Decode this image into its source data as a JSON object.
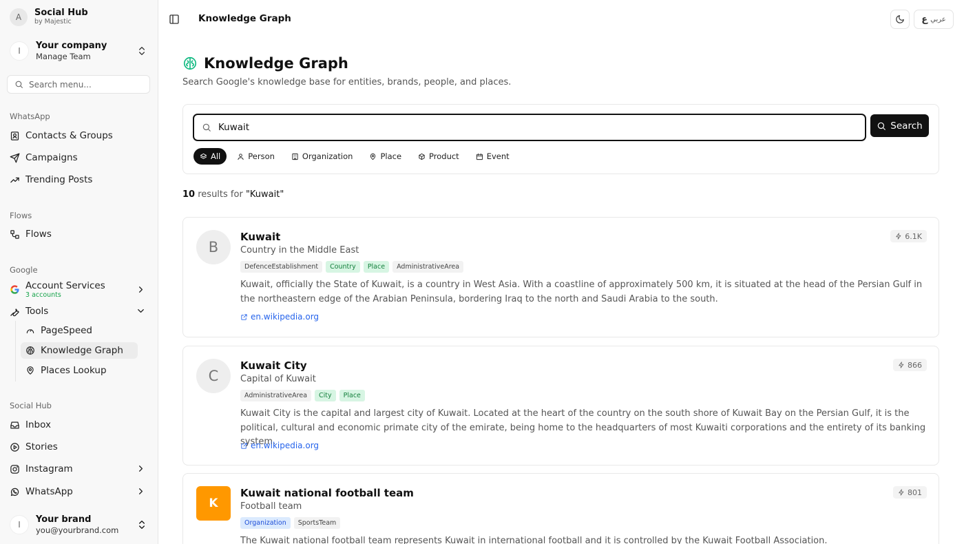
{
  "sidebar": {
    "brand": {
      "initial": "A",
      "name": "Social Hub",
      "sub": "by Majestic"
    },
    "company": {
      "initial": "I",
      "name": "Your company",
      "sub": "Manage Team"
    },
    "search_placeholder": "Search menu...",
    "sections": {
      "whatsapp": "WhatsApp",
      "flows": "Flows",
      "google": "Google",
      "social": "Social Hub"
    },
    "items": {
      "contacts": "Contacts & Groups",
      "campaigns": "Campaigns",
      "trending": "Trending Posts",
      "flows": "Flows",
      "account_services": "Account Services",
      "account_services_sub": "3 accounts",
      "tools": "Tools",
      "pagespeed": "PageSpeed",
      "knowledge_graph": "Knowledge Graph",
      "places_lookup": "Places Lookup",
      "inbox": "Inbox",
      "stories": "Stories",
      "instagram": "Instagram",
      "whatsapp": "WhatsApp"
    },
    "footer": {
      "initial": "I",
      "name": "Your brand",
      "email": "you@yourbrand.com"
    }
  },
  "header": {
    "title": "Knowledge Graph",
    "lang_glyph": "ع",
    "lang_label": "عربي"
  },
  "page": {
    "title": "Knowledge Graph",
    "subtitle": "Search Google's knowledge base for entities, brands, people, and places.",
    "search_value": "Kuwait",
    "search_button": "Search",
    "filters": [
      "All",
      "Person",
      "Organization",
      "Place",
      "Product",
      "Event"
    ],
    "results_count": "10",
    "results_text": "results for",
    "results_query": "\"Kuwait\"",
    "accent": "#10b981"
  },
  "results": [
    {
      "logo": "B",
      "name": "Kuwait",
      "description": "Country in the Middle East",
      "tags": [
        "DefenceEstablishment",
        "Country",
        "Place",
        "AdministrativeArea"
      ],
      "body": "Kuwait, officially the State of Kuwait, is a country in West Asia. With a coastline of approximately 500 km, it is situated at the head of the Persian Gulf in the northeastern edge of the Arabian Peninsula, bordering Iraq to the north and Saudi Arabia to the south.",
      "link": "en.wikipedia.org",
      "score": "6.1K"
    },
    {
      "logo": "C",
      "name": "Kuwait City",
      "description": "Capital of Kuwait",
      "tags": [
        "AdministrativeArea",
        "City",
        "Place"
      ],
      "body": "Kuwait City is the capital and largest city of Kuwait. Located at the heart of the country on the south shore of Kuwait Bay on the Persian Gulf, it is the political, cultural and economic primate city of the emirate, being home to the headquarters of most Kuwaiti corporations and the entirety of its banking system.",
      "link": "en.wikipedia.org",
      "score": "866"
    },
    {
      "logo": "K",
      "name": "Kuwait national football team",
      "description": "Football team",
      "tags": [
        "Organization",
        "SportsTeam"
      ],
      "body": "The Kuwait national football team represents Kuwait in international football and it is controlled by the Kuwait Football Association.",
      "link": "",
      "score": "801"
    }
  ]
}
